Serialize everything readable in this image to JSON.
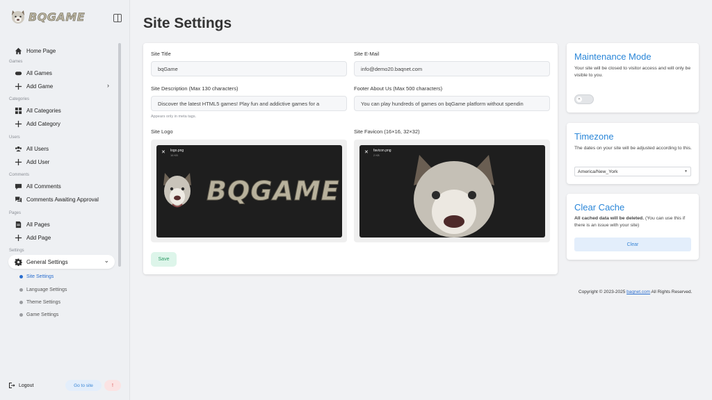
{
  "brand": {
    "name": "BQGAME"
  },
  "sidebar": {
    "home": "Home Page",
    "sections": {
      "games": "Games",
      "categories": "Categories",
      "users": "Users",
      "comments": "Comments",
      "pages": "Pages",
      "settings": "Settings"
    },
    "items": {
      "all_games": "All Games",
      "add_game": "Add Game",
      "all_categories": "All Categories",
      "add_category": "Add Category",
      "all_users": "All Users",
      "add_user": "Add User",
      "all_comments": "All Comments",
      "comments_awaiting": "Comments Awaiting Approval",
      "all_pages": "All Pages",
      "add_page": "Add Page",
      "general_settings": "General Settings"
    },
    "subitems": {
      "site_settings": "Site Settings",
      "language_settings": "Language Settings",
      "theme_settings": "Theme Settings",
      "game_settings": "Game Settings"
    },
    "footer": {
      "logout": "Logout",
      "goto_site": "Go to site",
      "alert": "!"
    }
  },
  "page": {
    "title": "Site Settings"
  },
  "form": {
    "site_title_label": "Site Title",
    "site_title_value": "bqGame",
    "site_email_label": "Site E-Mail",
    "site_email_value": "info@demo20.baqnet.com",
    "site_desc_label": "Site Description (Max 130 characters)",
    "site_desc_value": "Discover the latest HTML5 games! Play fun and addictive games for a",
    "site_desc_hint": "Appears only in meta tags.",
    "footer_about_label": "Footer About Us (Max 500 characters)",
    "footer_about_value": "You can play hundreds of games on bqGame platform without spendin",
    "logo_label": "Site Logo",
    "logo_file": "logo.png",
    "logo_size": "16 KB",
    "logo_text": "BQGAME",
    "favicon_label": "Site Favicon (16×16, 32×32)",
    "favicon_file": "favicon.png",
    "favicon_size": "2 KB",
    "save_label": "Save"
  },
  "maintenance": {
    "title": "Maintenance Mode",
    "text": "Your site will be closed to visitor access and will only be visible to you.",
    "toggle_on": false
  },
  "timezone": {
    "title": "Timezone",
    "text": "The dates on your site will be adjusted according to this.",
    "selected": "America/New_York"
  },
  "cache": {
    "title": "Clear Cache",
    "text_bold": "All cached data will be deleted.",
    "text_rest": " (You can use this if there is an issue with your site)",
    "button": "Clear"
  },
  "footer": {
    "copyright_pre": "Copyright © 2023-2025 ",
    "link": "baqnet.com",
    "copyright_post": " All Rights Reserved."
  },
  "colors": {
    "accent": "#2a86d8",
    "save": "#2c9a64",
    "danger": "#d64545"
  }
}
